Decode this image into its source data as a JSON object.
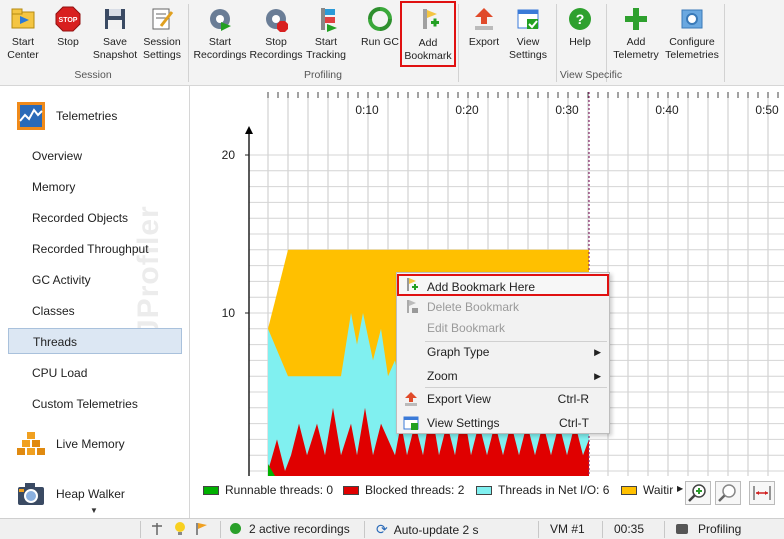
{
  "toolbar": {
    "groups": {
      "session": "Session",
      "profiling": "Profiling",
      "view_specific": "View Specific"
    },
    "buttons": {
      "start_center": "Start\nCenter",
      "stop": "Stop",
      "save_snapshot": "Save\nSnapshot",
      "session_settings": "Session\nSettings",
      "start_recordings": "Start\nRecordings",
      "stop_recordings": "Stop\nRecordings",
      "start_tracking": "Start\nTracking",
      "run_gc": "Run GC",
      "add_bookmark": "Add\nBookmark",
      "export": "Export",
      "view_settings": "View\nSettings",
      "help": "Help",
      "add_telemetry": "Add\nTelemetry",
      "configure_telemetries": "Configure\nTelemetries"
    }
  },
  "sidebar": {
    "telemetries": "Telemetries",
    "items": [
      "Overview",
      "Memory",
      "Recorded Objects",
      "Recorded Throughput",
      "GC Activity",
      "Classes",
      "Threads",
      "CPU Load",
      "Custom Telemetries"
    ],
    "active": "Threads",
    "live_memory": "Live Memory",
    "heap_walker": "Heap Walker",
    "watermark": "JProfiler"
  },
  "chart_data": {
    "type": "area",
    "x_ticks": [
      "0:10",
      "0:20",
      "0:30",
      "0:40",
      "0:50"
    ],
    "y_ticks": [
      "10",
      "20"
    ],
    "ylim": [
      0,
      20
    ],
    "series": [
      {
        "name": "Runnable threads",
        "color": "#00b000"
      },
      {
        "name": "Blocked threads",
        "color": "#e00000"
      },
      {
        "name": "Threads in Net I/O",
        "color": "#80f0f0"
      },
      {
        "name": "Waiting",
        "color": "#ffc000"
      }
    ]
  },
  "legend": {
    "runnable": "Runnable threads: 0",
    "blocked": "Blocked threads: 2",
    "net_io": "Threads in Net I/O: 6",
    "waiting": "Waitir"
  },
  "context_menu": {
    "add_bookmark_here": "Add Bookmark Here",
    "delete_bookmark": "Delete Bookmark",
    "edit_bookmark": "Edit Bookmark",
    "graph_type": "Graph Type",
    "zoom": "Zoom",
    "export_view": "Export View",
    "export_view_shortcut": "Ctrl-R",
    "view_settings": "View Settings",
    "view_settings_shortcut": "Ctrl-T"
  },
  "status": {
    "recordings": "2 active recordings",
    "auto_update": "Auto-update 2 s",
    "vm": "VM #1",
    "time": "00:35",
    "mode": "Profiling"
  }
}
